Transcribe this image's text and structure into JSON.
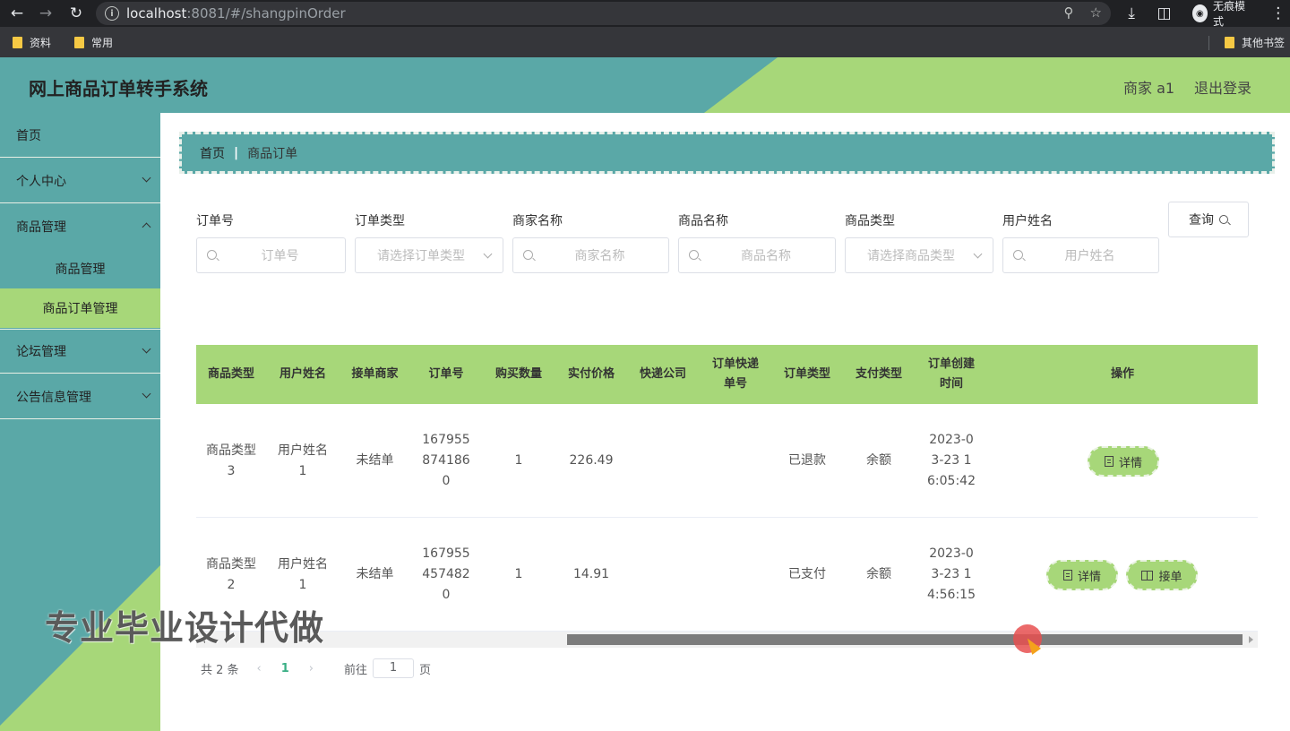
{
  "browser": {
    "url_host": "localhost",
    "url_rest": ":8081/#/shangpinOrder",
    "incognito_label": "无痕模式",
    "bookmarks": [
      "资料",
      "常用"
    ],
    "other_bookmarks": "其他书签"
  },
  "header": {
    "title": "网上商品订单转手系统",
    "user": "商家 a1",
    "logout": "退出登录"
  },
  "sidebar": {
    "items": [
      {
        "label": "首页"
      },
      {
        "label": "个人中心"
      },
      {
        "label": "商品管理"
      },
      {
        "label": "商品管理"
      },
      {
        "label": "商品订单管理"
      },
      {
        "label": "论坛管理"
      },
      {
        "label": "公告信息管理"
      }
    ]
  },
  "breadcrumb": {
    "home": "首页",
    "sep": "|",
    "current": "商品订单"
  },
  "search": {
    "fields": [
      {
        "label": "订单号",
        "placeholder": "订单号"
      },
      {
        "label": "订单类型",
        "placeholder": "请选择订单类型"
      },
      {
        "label": "商家名称",
        "placeholder": "商家名称"
      },
      {
        "label": "商品名称",
        "placeholder": "商品名称"
      },
      {
        "label": "商品类型",
        "placeholder": "请选择商品类型"
      },
      {
        "label": "用户姓名",
        "placeholder": "用户姓名"
      }
    ],
    "query_button": "查询"
  },
  "table": {
    "headers": [
      "商品类型",
      "用户姓名",
      "接单商家",
      "订单号",
      "购买数量",
      "实付价格",
      "快递公司",
      "订单快递单号",
      "订单类型",
      "支付类型",
      "订单创建时间",
      "操作"
    ],
    "rows": [
      {
        "type": "商品类型3",
        "user": "用户姓名1",
        "merchant": "未结单",
        "order_no": "1679558741860",
        "qty": "1",
        "price": "226.49",
        "express": "",
        "express_no": "",
        "order_type": "已退款",
        "pay_type": "余额",
        "created": "2023-03-23 16:05:42",
        "actions": [
          "详情"
        ]
      },
      {
        "type": "商品类型2",
        "user": "用户姓名1",
        "merchant": "未结单",
        "order_no": "1679554574820",
        "qty": "1",
        "price": "14.91",
        "express": "",
        "express_no": "",
        "order_type": "已支付",
        "pay_type": "余额",
        "created": "2023-03-23 14:56:15",
        "actions": [
          "详情",
          "接单"
        ]
      }
    ]
  },
  "pager": {
    "total": "共 2 条",
    "prev": "‹",
    "current": "1",
    "next": "›",
    "goto": "前往",
    "page_value": "1",
    "page_unit": "页"
  },
  "watermark": "专业毕业设计代做",
  "colors": {
    "teal": "#5aa8a7",
    "green": "#a7d779"
  }
}
